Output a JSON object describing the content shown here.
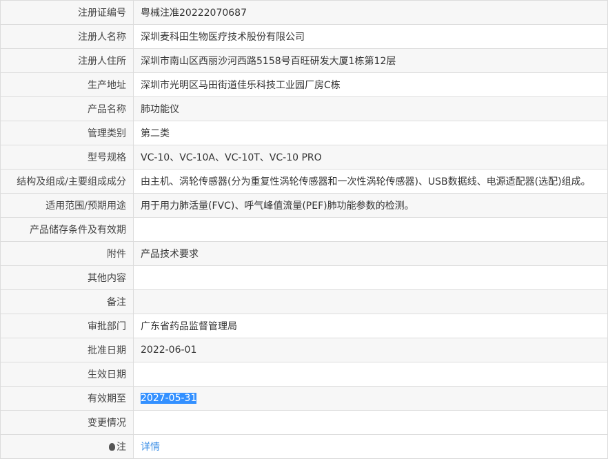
{
  "rows": [
    {
      "label": "注册证编号",
      "value": "粤械注准20222070687"
    },
    {
      "label": "注册人名称",
      "value": "深圳麦科田生物医疗技术股份有限公司"
    },
    {
      "label": "注册人住所",
      "value": "深圳市南山区西丽沙河西路5158号百旺研发大厦1栋第12层"
    },
    {
      "label": "生产地址",
      "value": "深圳市光明区马田街道佳乐科技工业园厂房C栋"
    },
    {
      "label": "产品名称",
      "value": "肺功能仪"
    },
    {
      "label": "管理类别",
      "value": "第二类"
    },
    {
      "label": "型号规格",
      "value": "VC-10、VC-10A、VC-10T、VC-10 PRO"
    },
    {
      "label": "结构及组成/主要组成成分",
      "value": "由主机、涡轮传感器(分为重复性涡轮传感器和一次性涡轮传感器)、USB数据线、电源适配器(选配)组成。"
    },
    {
      "label": "适用范围/预期用途",
      "value": "用于用力肺活量(FVC)、呼气峰值流量(PEF)肺功能参数的检测。"
    },
    {
      "label": "产品储存条件及有效期",
      "value": ""
    },
    {
      "label": "附件",
      "value": "产品技术要求"
    },
    {
      "label": "其他内容",
      "value": ""
    },
    {
      "label": "备注",
      "value": ""
    },
    {
      "label": "审批部门",
      "value": "广东省药品监督管理局"
    },
    {
      "label": "批准日期",
      "value": "2022-06-01"
    },
    {
      "label": "生效日期",
      "value": ""
    },
    {
      "label": "有效期至",
      "value": "2027-05-31"
    },
    {
      "label": "变更情况",
      "value": ""
    }
  ],
  "note": {
    "label": "注",
    "link": "详情",
    "icon": "lightbulb-icon"
  }
}
